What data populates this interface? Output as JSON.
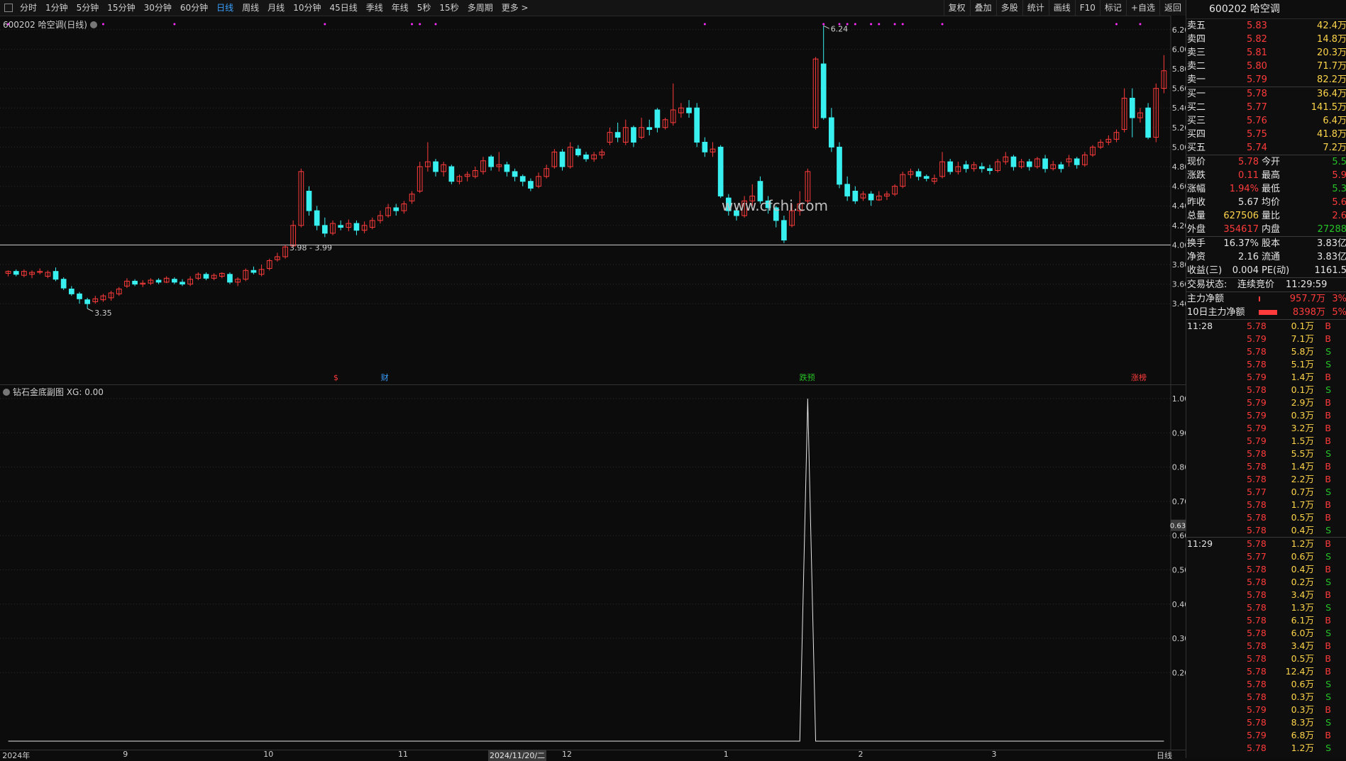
{
  "toolbar": {
    "periods": [
      "分时",
      "1分钟",
      "5分钟",
      "15分钟",
      "30分钟",
      "60分钟",
      "日线",
      "周线",
      "月线",
      "10分钟",
      "45日线",
      "季线",
      "年线",
      "5秒",
      "15秒",
      "多周期",
      "更多 >"
    ],
    "active_period": "日线",
    "right_buttons": [
      "复权",
      "叠加",
      "多股",
      "统计",
      "画线",
      "F10",
      "标记",
      "+自选",
      "返回"
    ]
  },
  "main_panel": {
    "title": "600202 哈空调(日线)",
    "price_labels": [
      "6.20",
      "6.00",
      "5.80",
      "5.60",
      "5.40",
      "5.20",
      "5.00",
      "4.80",
      "4.60",
      "4.40",
      "4.20",
      "4.00",
      "3.80",
      "3.60",
      "3.40"
    ],
    "annotations": {
      "high": "6.24",
      "low": "3.35",
      "range": "3.98 - 3.99"
    },
    "markers": [
      {
        "text": "$",
        "color": "#ff3b3b"
      },
      {
        "text": "财",
        "color": "#3aa0ff"
      },
      {
        "text": "跌预",
        "color": "#27c227"
      },
      {
        "text": "涨榜",
        "color": "#ff3b3b"
      }
    ],
    "watermark": "www.cfchi.com"
  },
  "sub_panel": {
    "title": "钻石金底副图 XG: 0.00",
    "y_labels": [
      "1.00",
      "0.90",
      "0.80",
      "0.70",
      "0.60",
      "0.50",
      "0.40",
      "0.30",
      "0.20"
    ],
    "cursor_value": "0.63"
  },
  "x_axis": {
    "labels": [
      "2024年",
      "9",
      "10",
      "11",
      "12",
      "1",
      "2",
      "3"
    ],
    "cursor_date": "2024/11/20/二",
    "corner": "日线"
  },
  "chart_data": {
    "type": "candlestick",
    "title": "600202 哈空调(日线)",
    "ylim": [
      3.3,
      6.3
    ],
    "high_label": 6.24,
    "low_label": 3.35,
    "candles": [
      [
        3.71,
        3.73,
        3.68,
        3.74
      ],
      [
        3.73,
        3.7,
        3.68,
        3.75
      ],
      [
        3.69,
        3.73,
        3.67,
        3.75
      ],
      [
        3.7,
        3.72,
        3.66,
        3.74
      ],
      [
        3.72,
        3.73,
        3.7,
        3.76
      ],
      [
        3.68,
        3.72,
        3.66,
        3.74
      ],
      [
        3.73,
        3.65,
        3.63,
        3.77
      ],
      [
        3.65,
        3.56,
        3.54,
        3.67
      ],
      [
        3.55,
        3.5,
        3.48,
        3.58
      ],
      [
        3.5,
        3.45,
        3.4,
        3.52
      ],
      [
        3.44,
        3.4,
        3.35,
        3.46
      ],
      [
        3.42,
        3.45,
        3.4,
        3.48
      ],
      [
        3.44,
        3.48,
        3.42,
        3.5
      ],
      [
        3.46,
        3.51,
        3.43,
        3.53
      ],
      [
        3.5,
        3.55,
        3.48,
        3.57
      ],
      [
        3.58,
        3.63,
        3.56,
        3.66
      ],
      [
        3.63,
        3.6,
        3.58,
        3.65
      ],
      [
        3.6,
        3.61,
        3.57,
        3.64
      ],
      [
        3.61,
        3.64,
        3.59,
        3.66
      ],
      [
        3.64,
        3.62,
        3.6,
        3.66
      ],
      [
        3.62,
        3.66,
        3.61,
        3.68
      ],
      [
        3.65,
        3.62,
        3.6,
        3.67
      ],
      [
        3.62,
        3.6,
        3.58,
        3.65
      ],
      [
        3.6,
        3.65,
        3.58,
        3.68
      ],
      [
        3.66,
        3.7,
        3.64,
        3.72
      ],
      [
        3.7,
        3.66,
        3.64,
        3.72
      ],
      [
        3.66,
        3.69,
        3.64,
        3.71
      ],
      [
        3.68,
        3.71,
        3.66,
        3.72
      ],
      [
        3.7,
        3.62,
        3.6,
        3.72
      ],
      [
        3.62,
        3.65,
        3.58,
        3.67
      ],
      [
        3.65,
        3.74,
        3.63,
        3.76
      ],
      [
        3.74,
        3.72,
        3.7,
        3.78
      ],
      [
        3.7,
        3.75,
        3.68,
        3.8
      ],
      [
        3.76,
        3.84,
        3.74,
        3.86
      ],
      [
        3.85,
        3.88,
        3.83,
        3.92
      ],
      [
        3.88,
        3.98,
        3.86,
        4.0
      ],
      [
        3.99,
        4.2,
        3.98,
        4.25
      ],
      [
        4.2,
        4.75,
        4.18,
        4.78
      ],
      [
        4.55,
        4.35,
        4.3,
        4.6
      ],
      [
        4.35,
        4.2,
        4.15,
        4.4
      ],
      [
        4.2,
        4.12,
        4.08,
        4.28
      ],
      [
        4.12,
        4.22,
        4.1,
        4.25
      ],
      [
        4.2,
        4.18,
        4.15,
        4.25
      ],
      [
        4.18,
        4.22,
        4.14,
        4.26
      ],
      [
        4.22,
        4.15,
        4.1,
        4.25
      ],
      [
        4.15,
        4.2,
        4.12,
        4.24
      ],
      [
        4.18,
        4.25,
        4.16,
        4.28
      ],
      [
        4.25,
        4.3,
        4.22,
        4.35
      ],
      [
        4.3,
        4.38,
        4.28,
        4.42
      ],
      [
        4.38,
        4.35,
        4.3,
        4.42
      ],
      [
        4.35,
        4.42,
        4.32,
        4.45
      ],
      [
        4.45,
        4.52,
        4.42,
        4.55
      ],
      [
        4.55,
        4.8,
        4.53,
        4.85
      ],
      [
        4.8,
        4.85,
        4.75,
        5.05
      ],
      [
        4.85,
        4.75,
        4.7,
        4.88
      ],
      [
        4.75,
        4.82,
        4.7,
        4.85
      ],
      [
        4.8,
        4.65,
        4.62,
        4.82
      ],
      [
        4.65,
        4.7,
        4.62,
        4.72
      ],
      [
        4.7,
        4.72,
        4.65,
        4.75
      ],
      [
        4.7,
        4.76,
        4.68,
        4.8
      ],
      [
        4.75,
        4.86,
        4.72,
        4.9
      ],
      [
        4.9,
        4.8,
        4.76,
        4.92
      ],
      [
        4.8,
        4.82,
        4.75,
        4.95
      ],
      [
        4.82,
        4.75,
        4.7,
        4.85
      ],
      [
        4.75,
        4.7,
        4.65,
        4.78
      ],
      [
        4.7,
        4.65,
        4.6,
        4.72
      ],
      [
        4.65,
        4.58,
        4.55,
        4.68
      ],
      [
        4.6,
        4.7,
        4.58,
        4.74
      ],
      [
        4.7,
        4.78,
        4.68,
        4.82
      ],
      [
        4.8,
        4.95,
        4.78,
        4.98
      ],
      [
        4.95,
        4.8,
        4.76,
        4.98
      ],
      [
        4.8,
        5.0,
        4.78,
        5.05
      ],
      [
        4.98,
        4.92,
        4.9,
        5.02
      ],
      [
        4.92,
        4.88,
        4.85,
        4.95
      ],
      [
        4.88,
        4.92,
        4.85,
        4.95
      ],
      [
        4.92,
        4.95,
        4.88,
        4.98
      ],
      [
        5.05,
        5.15,
        5.02,
        5.2
      ],
      [
        5.15,
        5.1,
        5.05,
        5.25
      ],
      [
        5.05,
        5.2,
        5.02,
        5.28
      ],
      [
        5.2,
        5.05,
        5.0,
        5.22
      ],
      [
        5.1,
        5.2,
        5.08,
        5.3
      ],
      [
        5.2,
        5.18,
        5.12,
        5.28
      ],
      [
        5.38,
        5.2,
        5.15,
        5.4
      ],
      [
        5.2,
        5.28,
        5.18,
        5.3
      ],
      [
        5.25,
        5.38,
        5.22,
        5.65
      ],
      [
        5.35,
        5.4,
        5.3,
        5.45
      ],
      [
        5.4,
        5.35,
        5.3,
        5.48
      ],
      [
        5.4,
        5.05,
        5.0,
        5.45
      ],
      [
        5.05,
        4.95,
        4.9,
        5.1
      ],
      [
        4.95,
        4.98,
        4.9,
        5.05
      ],
      [
        5.0,
        4.5,
        4.48,
        5.02
      ],
      [
        4.48,
        4.35,
        4.3,
        4.52
      ],
      [
        4.35,
        4.3,
        4.25,
        4.38
      ],
      [
        4.3,
        4.45,
        4.28,
        4.5
      ],
      [
        4.45,
        4.5,
        4.4,
        4.62
      ],
      [
        4.65,
        4.45,
        4.42,
        4.7
      ],
      [
        4.45,
        4.38,
        4.32,
        4.5
      ],
      [
        4.38,
        4.25,
        4.18,
        4.4
      ],
      [
        4.25,
        4.05,
        4.02,
        4.3
      ],
      [
        4.2,
        4.35,
        4.18,
        4.42
      ],
      [
        4.35,
        4.42,
        4.3,
        4.55
      ],
      [
        4.45,
        4.75,
        4.42,
        4.78
      ],
      [
        5.2,
        5.9,
        5.18,
        5.92
      ],
      [
        5.85,
        5.3,
        5.28,
        6.24
      ],
      [
        5.3,
        5.0,
        4.95,
        5.4
      ],
      [
        5.0,
        4.62,
        4.58,
        5.05
      ],
      [
        4.62,
        4.5,
        4.45,
        4.7
      ],
      [
        4.55,
        4.45,
        4.42,
        4.6
      ],
      [
        4.48,
        4.52,
        4.45,
        4.55
      ],
      [
        4.52,
        4.46,
        4.4,
        4.55
      ],
      [
        4.46,
        4.5,
        4.45,
        4.55
      ],
      [
        4.5,
        4.52,
        4.46,
        4.55
      ],
      [
        4.52,
        4.6,
        4.5,
        4.62
      ],
      [
        4.6,
        4.72,
        4.58,
        4.75
      ],
      [
        4.72,
        4.75,
        4.68,
        4.78
      ],
      [
        4.75,
        4.7,
        4.66,
        4.78
      ],
      [
        4.7,
        4.68,
        4.65,
        4.72
      ],
      [
        4.65,
        4.68,
        4.62,
        4.72
      ],
      [
        4.7,
        4.85,
        4.68,
        4.95
      ],
      [
        4.85,
        4.75,
        4.72,
        4.88
      ],
      [
        4.75,
        4.8,
        4.72,
        4.85
      ],
      [
        4.82,
        4.78,
        4.74,
        4.86
      ],
      [
        4.78,
        4.82,
        4.75,
        4.85
      ],
      [
        4.8,
        4.78,
        4.74,
        4.84
      ],
      [
        4.78,
        4.76,
        4.72,
        4.82
      ],
      [
        4.76,
        4.85,
        4.74,
        4.88
      ],
      [
        4.85,
        4.9,
        4.82,
        4.95
      ],
      [
        4.9,
        4.8,
        4.76,
        4.92
      ],
      [
        4.8,
        4.85,
        4.78,
        4.88
      ],
      [
        4.85,
        4.8,
        4.76,
        4.88
      ],
      [
        4.8,
        4.88,
        4.78,
        4.9
      ],
      [
        4.88,
        4.78,
        4.74,
        4.92
      ],
      [
        4.78,
        4.82,
        4.76,
        4.86
      ],
      [
        4.82,
        4.78,
        4.74,
        4.85
      ],
      [
        4.85,
        4.88,
        4.8,
        4.92
      ],
      [
        4.88,
        4.82,
        4.78,
        4.9
      ],
      [
        4.82,
        4.92,
        4.8,
        4.95
      ],
      [
        4.92,
        5.0,
        4.9,
        5.02
      ],
      [
        5.0,
        5.05,
        4.98,
        5.08
      ],
      [
        5.05,
        5.08,
        5.02,
        5.12
      ],
      [
        5.08,
        5.15,
        5.05,
        5.18
      ],
      [
        5.18,
        5.5,
        5.15,
        5.6
      ],
      [
        5.5,
        5.3,
        5.1,
        5.6
      ],
      [
        5.3,
        5.35,
        5.25,
        5.4
      ],
      [
        5.4,
        5.1,
        5.08,
        5.45
      ],
      [
        5.1,
        5.6,
        5.05,
        5.65
      ],
      [
        5.6,
        5.78,
        5.55,
        5.94
      ]
    ],
    "indicator": {
      "name": "钻石金底副图",
      "XG": 0.0,
      "ylim": [
        0.0,
        1.0
      ],
      "spike_index": 101,
      "spike_value": 1.0
    }
  },
  "quote": {
    "header": "600202 哈空调",
    "sells": [
      {
        "label": "卖五",
        "price": "5.83",
        "vol": "42.4万"
      },
      {
        "label": "卖四",
        "price": "5.82",
        "vol": "14.8万"
      },
      {
        "label": "卖三",
        "price": "5.81",
        "vol": "20.3万"
      },
      {
        "label": "卖二",
        "price": "5.80",
        "vol": "71.7万"
      },
      {
        "label": "卖一",
        "price": "5.79",
        "vol": "82.2万"
      }
    ],
    "buys": [
      {
        "label": "买一",
        "price": "5.78",
        "vol": "36.4万"
      },
      {
        "label": "买二",
        "price": "5.77",
        "vol": "141.5万"
      },
      {
        "label": "买三",
        "price": "5.76",
        "vol": "6.4万"
      },
      {
        "label": "买四",
        "price": "5.75",
        "vol": "41.8万"
      },
      {
        "label": "买五",
        "price": "5.74",
        "vol": "7.2万"
      }
    ],
    "stats": [
      {
        "l1": "现价",
        "v1": "5.78",
        "c1": "red",
        "l2": "今开",
        "v2": "5.5",
        "c2": "green"
      },
      {
        "l1": "涨跌",
        "v1": "0.11",
        "c1": "red",
        "l2": "最高",
        "v2": "5.9",
        "c2": "red"
      },
      {
        "l1": "涨幅",
        "v1": "1.94%",
        "c1": "red",
        "l2": "最低",
        "v2": "5.3",
        "c2": "green"
      },
      {
        "l1": "昨收",
        "v1": "5.67",
        "c1": "white",
        "l2": "均价",
        "v2": "5.6",
        "c2": "red"
      },
      {
        "l1": "总量",
        "v1": "627506",
        "c1": "yellow",
        "l2": "量比",
        "v2": "2.6",
        "c2": "red"
      },
      {
        "l1": "外盘",
        "v1": "354617",
        "c1": "red",
        "l2": "内盘",
        "v2": "27288",
        "c2": "green"
      }
    ],
    "stats2": [
      {
        "l1": "换手",
        "v1": "16.37%",
        "l2": "股本",
        "v2": "3.83亿"
      },
      {
        "l1": "净资",
        "v1": "2.16",
        "l2": "流通",
        "v2": "3.83亿"
      },
      {
        "l1": "收益(三)",
        "v1": "0.004",
        "l2": "PE(动)",
        "v2": "1161.5"
      }
    ],
    "trade_status_label": "交易状态:",
    "trade_status": "连续竞价",
    "trade_time": "11:29:59",
    "main_net_label": "主力净额",
    "main_net": "957.7万",
    "main_net_pct": "3%",
    "main_net10_label": "10日主力净额",
    "main_net10": "8398万",
    "main_net10_pct": "5%"
  },
  "ticks": [
    {
      "time": "11:28",
      "price": "5.78",
      "vol": "0.1万",
      "side": "B"
    },
    {
      "time": "",
      "price": "5.79",
      "vol": "7.1万",
      "side": "B"
    },
    {
      "time": "",
      "price": "5.78",
      "vol": "5.8万",
      "side": "S"
    },
    {
      "time": "",
      "price": "5.78",
      "vol": "5.1万",
      "side": "S"
    },
    {
      "time": "",
      "price": "5.79",
      "vol": "1.4万",
      "side": "B"
    },
    {
      "time": "",
      "price": "5.78",
      "vol": "0.1万",
      "side": "S"
    },
    {
      "time": "",
      "price": "5.79",
      "vol": "2.9万",
      "side": "B"
    },
    {
      "time": "",
      "price": "5.79",
      "vol": "0.3万",
      "side": "B"
    },
    {
      "time": "",
      "price": "5.79",
      "vol": "3.2万",
      "side": "B"
    },
    {
      "time": "",
      "price": "5.79",
      "vol": "1.5万",
      "side": "B"
    },
    {
      "time": "",
      "price": "5.78",
      "vol": "5.5万",
      "side": "S"
    },
    {
      "time": "",
      "price": "5.78",
      "vol": "1.4万",
      "side": "B"
    },
    {
      "time": "",
      "price": "5.78",
      "vol": "2.2万",
      "side": "B"
    },
    {
      "time": "",
      "price": "5.77",
      "vol": "0.7万",
      "side": "S"
    },
    {
      "time": "",
      "price": "5.78",
      "vol": "1.7万",
      "side": "B"
    },
    {
      "time": "",
      "price": "5.78",
      "vol": "0.5万",
      "side": "B"
    },
    {
      "time": "",
      "price": "5.78",
      "vol": "0.4万",
      "side": "S"
    },
    {
      "time": "11:29",
      "price": "5.78",
      "vol": "1.2万",
      "side": "B"
    },
    {
      "time": "",
      "price": "5.77",
      "vol": "0.6万",
      "side": "S"
    },
    {
      "time": "",
      "price": "5.78",
      "vol": "0.4万",
      "side": "B"
    },
    {
      "time": "",
      "price": "5.78",
      "vol": "0.2万",
      "side": "S"
    },
    {
      "time": "",
      "price": "5.78",
      "vol": "3.4万",
      "side": "B"
    },
    {
      "time": "",
      "price": "5.78",
      "vol": "1.3万",
      "side": "S"
    },
    {
      "time": "",
      "price": "5.78",
      "vol": "6.1万",
      "side": "B"
    },
    {
      "time": "",
      "price": "5.78",
      "vol": "6.0万",
      "side": "S"
    },
    {
      "time": "",
      "price": "5.78",
      "vol": "3.4万",
      "side": "B"
    },
    {
      "time": "",
      "price": "5.78",
      "vol": "0.5万",
      "side": "B"
    },
    {
      "time": "",
      "price": "5.78",
      "vol": "12.4万",
      "side": "B"
    },
    {
      "time": "",
      "price": "5.78",
      "vol": "0.6万",
      "side": "S"
    },
    {
      "time": "",
      "price": "5.78",
      "vol": "0.3万",
      "side": "S"
    },
    {
      "time": "",
      "price": "5.79",
      "vol": "0.3万",
      "side": "B"
    },
    {
      "time": "",
      "price": "5.78",
      "vol": "8.3万",
      "side": "S"
    },
    {
      "time": "",
      "price": "5.79",
      "vol": "6.8万",
      "side": "B"
    },
    {
      "time": "",
      "price": "5.78",
      "vol": "1.2万",
      "side": "S"
    }
  ],
  "colors": {
    "up": "#ff3b3b",
    "down": "#38f0f0",
    "bg": "#0c0c0c",
    "grid": "#2b2b2b",
    "marker": "#ff2cff"
  }
}
